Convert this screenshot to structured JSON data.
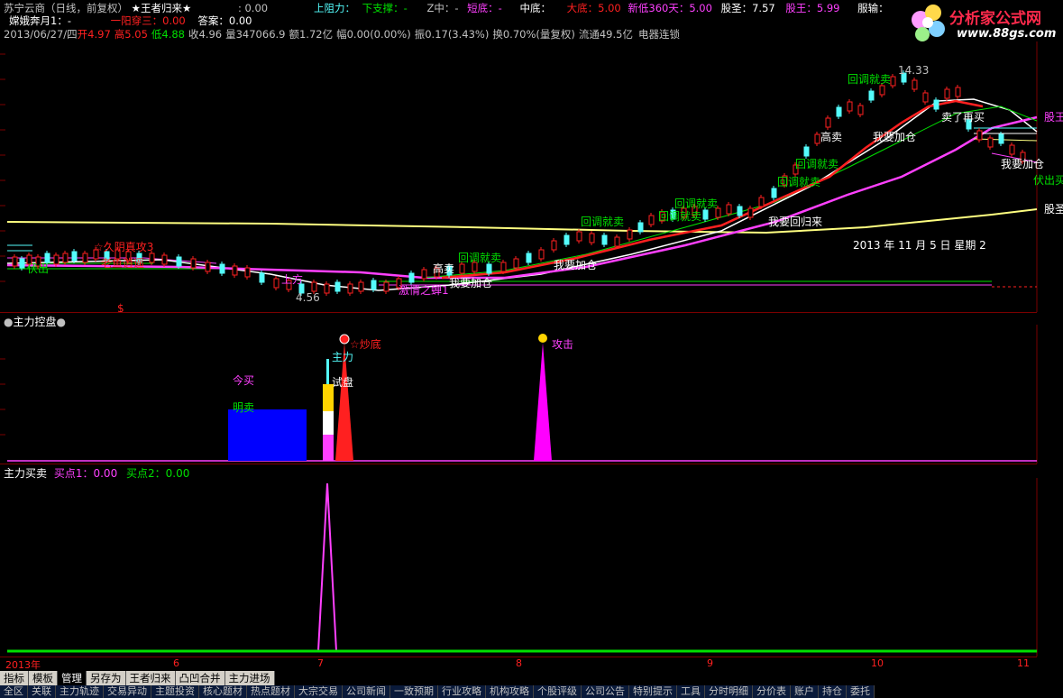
{
  "header": {
    "row1": {
      "stock": "苏宁云商（日线，前复权）",
      "formula": "★王者归来★",
      "formula_value": ": 0.00",
      "upper_resistance_label": "上阻力：",
      "lower_support_label": "下支撑：-",
      "z_label": "Z中：-",
      "short_bottom_label": "短底：-",
      "mid_bottom_label": "中底：",
      "big_bottom_label": "大底：5.00",
      "new_low_label": "新低360天：5.00",
      "stock_sage_label": "股圣：7.57",
      "stock_king_label": "股王：5.99",
      "submit_label": "服输："
    },
    "row2": {
      "line_label": "嫦娥奔月1：-",
      "yiyang_label": "一阳穿三：0.00",
      "answer_label": "答案：0.00"
    },
    "row3": {
      "date": "2013/06/27/四",
      "open": "开4.97",
      "high": "高5.05",
      "low": "低4.88",
      "close": "收4.96",
      "volume": "量347066.9",
      "amount": "额1.72亿",
      "amplitude_change": "幅0.00(0.00%)",
      "swing": "振0.17(3.43%)",
      "turnover": "换0.70%(量复权)",
      "float": "流通49.5亿",
      "sector": "电器连锁"
    }
  },
  "logo": {
    "text": "分析家公式网",
    "url": "www.88gs.com"
  },
  "main_chart": {
    "annotations": {
      "fuchu": "伏出",
      "jiuyin": "☆久阴真攻3",
      "laoyu": "老鱼逍遥",
      "hui_tiao_1": "回调就卖",
      "hui_tiao_2": "回调就卖",
      "hui_tiao_3": "回调就卖",
      "hui_tiao_4": "回调就卖",
      "hui_tiao_5": "回调就卖",
      "hui_tiao_6": "回调就卖",
      "hui_tiao_7": "回调就卖",
      "gao_mai_1": "高卖",
      "gao_mai_2": "高卖",
      "wo_yao_1": "我要加仓",
      "wo_yao_2": "我要加仓",
      "wo_yao_3": "我要加仓",
      "wo_yao_4": "我要加仓",
      "wo_yao_gui": "我要回归来",
      "mai_le": "卖了再买",
      "gu_wang": "股王",
      "gu_sheng": "股圣",
      "fu_chu_mai": "伏出买",
      "shang_fang": "上方",
      "jiao_li": "激情之蝉1",
      "high_price": "14.33",
      "low_price": "4.56",
      "s_mark": "$",
      "date_label": "2013 年 11 月 5 日 星期 2"
    }
  },
  "control_panel": {
    "title": "主力控盘",
    "labels": {
      "jin_mai": "今买",
      "ming_mai": "明卖",
      "zhu_li": "主力",
      "shi_pan": "试盘",
      "chao_di": "☆炒底",
      "gong_ji": "攻击"
    }
  },
  "buy_panel": {
    "title": "主力买卖",
    "buy1": "买点1：0.00",
    "buy2": "买点2：0.00"
  },
  "x_axis": [
    "2013年",
    "6",
    "7",
    "8",
    "9",
    "10",
    "11"
  ],
  "tabs": [
    {
      "label": "指标",
      "active": false
    },
    {
      "label": "模板",
      "active": false
    },
    {
      "label": "管理",
      "active": true
    },
    {
      "label": "另存为",
      "active": false
    },
    {
      "label": "王者归来",
      "active": false
    },
    {
      "label": "凸凹合并",
      "active": false
    },
    {
      "label": "主力进场",
      "active": false
    }
  ],
  "bottom_tabs": [
    "全区",
    "关联",
    "主力轨迹",
    "交易异动",
    "主题投资",
    "核心题材",
    "热点题材",
    "大宗交易",
    "公司新闻",
    "一致预期",
    "行业攻略",
    "机构攻略",
    "个股评级",
    "公司公告",
    "特别提示",
    "工具",
    "分时明细",
    "分价表",
    "账户",
    "持仓",
    "委托"
  ],
  "colors": {
    "red_ma": "#ff2020",
    "magenta_ma": "#ff40ff",
    "yellow_ma": "#ffff80",
    "cyan_candle": "#54fcfc",
    "green_text": "#00e000",
    "bar_blue": "#0000ff",
    "bar_magenta": "#ff00ff"
  }
}
